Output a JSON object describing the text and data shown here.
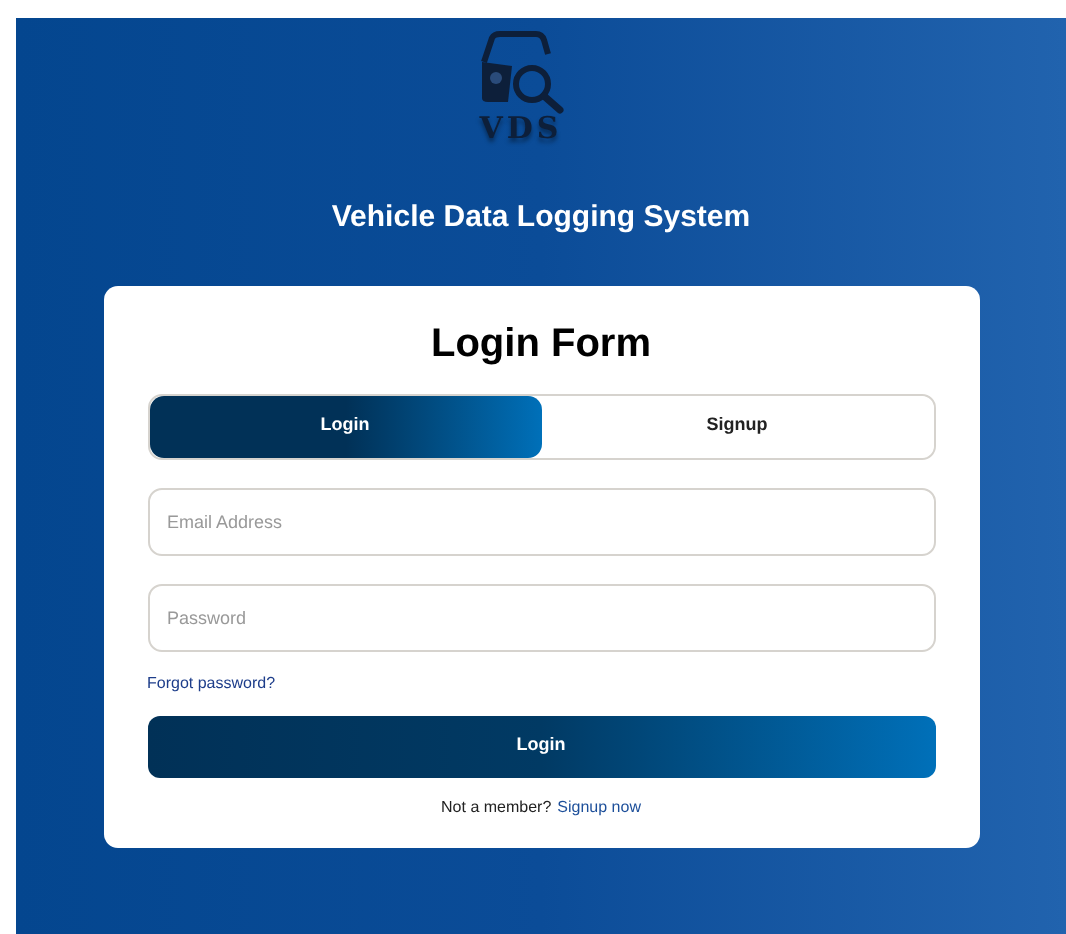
{
  "logo": {
    "text": "VDS"
  },
  "app_title": "Vehicle Data Logging System",
  "form": {
    "title": "Login Form",
    "tabs": [
      {
        "label": "Login",
        "selected": true
      },
      {
        "label": "Signup",
        "selected": false
      }
    ],
    "fields": [
      {
        "placeholder": "Email Address"
      },
      {
        "placeholder": "Password"
      }
    ],
    "forgot_link": "Forgot password?",
    "submit": "Login",
    "footer": {
      "text": "Not a member?",
      "link": "Signup now"
    }
  }
}
